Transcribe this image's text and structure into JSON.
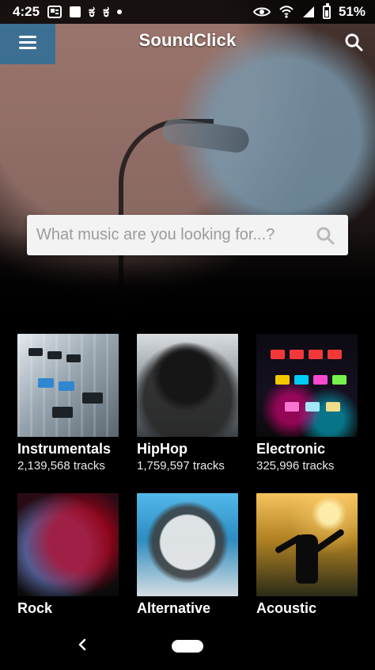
{
  "status_bar": {
    "time": "4:25",
    "battery_percent": "51%",
    "icons": [
      "notification-icon",
      "square-icon",
      "lang-icon",
      "lang-icon",
      "dot-icon",
      "eye-icon",
      "wifi-icon",
      "signal-icon",
      "battery-icon"
    ]
  },
  "header": {
    "title": "SoundClick",
    "menu_icon": "menu-icon",
    "search_icon": "search-icon",
    "accent_color": "#3d6f93"
  },
  "search": {
    "placeholder": "What music are you looking for...?"
  },
  "genres": [
    {
      "name": "Instrumentals",
      "tracks": "2,139,568 tracks"
    },
    {
      "name": "HipHop",
      "tracks": "1,759,597 tracks"
    },
    {
      "name": "Electronic",
      "tracks": "325,996 tracks"
    },
    {
      "name": "Rock",
      "tracks": ""
    },
    {
      "name": "Alternative",
      "tracks": ""
    },
    {
      "name": "Acoustic",
      "tracks": ""
    }
  ],
  "navigation": {
    "back_icon": "back-icon",
    "home_icon": "home-pill-icon"
  }
}
